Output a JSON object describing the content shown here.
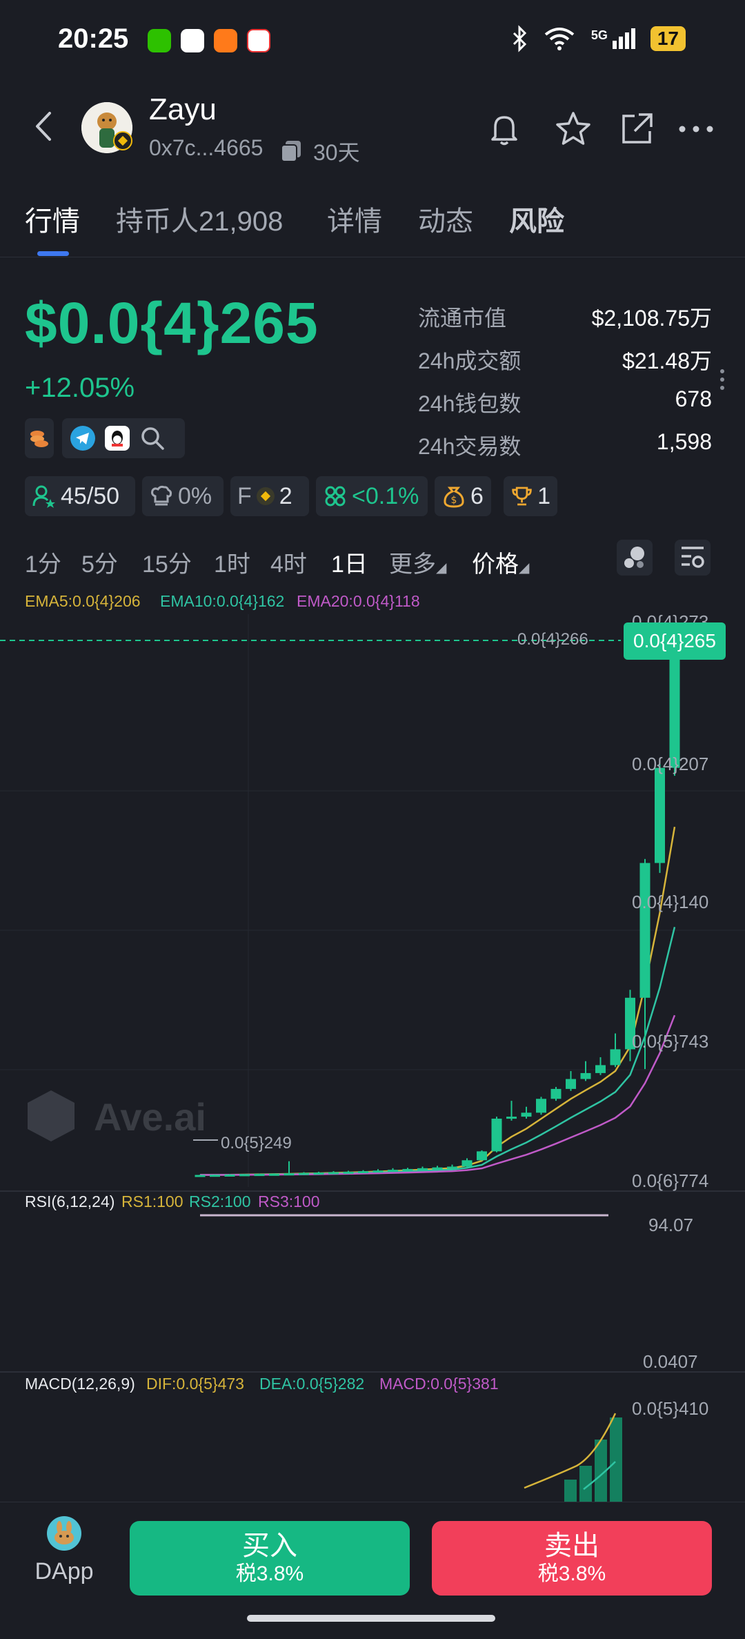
{
  "status_bar": {
    "time": "20:25",
    "network": "5G",
    "battery": "17"
  },
  "header": {
    "token_name": "Zayu",
    "address": "0x7c...4665",
    "age": "30天",
    "icons": [
      "back-icon",
      "bell-icon",
      "star-icon",
      "share-icon",
      "more-icon"
    ]
  },
  "tabs": [
    "行情",
    "持币人21,908",
    "详情",
    "动态",
    "风险"
  ],
  "price": {
    "value": "$0.0{4}265",
    "change": "+12.05%"
  },
  "stats": [
    {
      "label": "流通市值",
      "value": "$2,108.75万"
    },
    {
      "label": "24h成交额",
      "value": "$21.48万"
    },
    {
      "label": "24h钱包数",
      "value": "678"
    },
    {
      "label": "24h交易数",
      "value": "1,598"
    }
  ],
  "badges": {
    "holders": "45/50",
    "tax": "0%",
    "f_label": "F",
    "f_count": "2",
    "ratio": "<0.1%",
    "bag_count": "6",
    "trophy_count": "1"
  },
  "intervals": [
    "1分",
    "5分",
    "15分",
    "1时",
    "4时",
    "1日",
    "更多",
    "价格"
  ],
  "active_interval": "1日",
  "chart_labels": {
    "ema5": "EMA5:0.0{4}206",
    "ema10": "EMA10:0.0{4}162",
    "ema20": "EMA20:0.0{4}118",
    "y_ticks": [
      "0.0{4}273",
      "0.0{4}207",
      "0.0{4}140",
      "0.0{5}743",
      "0.0{6}774"
    ],
    "high_marker": "0.0{4}266",
    "current_tag": "0.0{4}265",
    "low_marker": "0.0{5}249",
    "watermark": "Ave.ai",
    "rsi_title": "RSI(6,12,24)",
    "rs1": "RS1:100",
    "rs2": "RS2:100",
    "rs3": "RS3:100",
    "rsi_hi": "94.07",
    "rsi_lo": "0.0407",
    "macd_title": "MACD(12,26,9)",
    "dif": "DIF:0.0{5}473",
    "dea": "DEA:0.0{5}282",
    "macd": "MACD:0.0{5}381",
    "macd_tick": "0.0{5}410"
  },
  "colors": {
    "up": "#1ec58e",
    "down": "#f23f5a",
    "ema5": "#d6b43a",
    "ema10": "#2fc4a3",
    "ema20": "#c05ac8",
    "accent": "#3e78f0"
  },
  "chart_data": {
    "type": "candlestick",
    "note_units": "price in units of 1e-5 USD",
    "candles": [
      {
        "o": 0.25,
        "c": 0.26,
        "h": 0.27,
        "l": 0.24
      },
      {
        "o": 0.26,
        "c": 0.27,
        "h": 0.28,
        "l": 0.25
      },
      {
        "o": 0.27,
        "c": 0.28,
        "h": 0.3,
        "l": 0.26
      },
      {
        "o": 0.28,
        "c": 0.3,
        "h": 0.31,
        "l": 0.27
      },
      {
        "o": 0.3,
        "c": 0.31,
        "h": 0.33,
        "l": 0.29
      },
      {
        "o": 0.31,
        "c": 0.32,
        "h": 0.34,
        "l": 0.3
      },
      {
        "o": 0.32,
        "c": 0.34,
        "h": 0.95,
        "l": 0.31
      },
      {
        "o": 0.34,
        "c": 0.36,
        "h": 0.4,
        "l": 0.33
      },
      {
        "o": 0.36,
        "c": 0.38,
        "h": 0.42,
        "l": 0.35
      },
      {
        "o": 0.38,
        "c": 0.4,
        "h": 0.45,
        "l": 0.37
      },
      {
        "o": 0.4,
        "c": 0.42,
        "h": 0.47,
        "l": 0.39
      },
      {
        "o": 0.42,
        "c": 0.45,
        "h": 0.5,
        "l": 0.41
      },
      {
        "o": 0.45,
        "c": 0.48,
        "h": 0.55,
        "l": 0.44
      },
      {
        "o": 0.48,
        "c": 0.52,
        "h": 0.6,
        "l": 0.47
      },
      {
        "o": 0.52,
        "c": 0.56,
        "h": 0.62,
        "l": 0.51
      },
      {
        "o": 0.56,
        "c": 0.6,
        "h": 0.68,
        "l": 0.55
      },
      {
        "o": 0.6,
        "c": 0.64,
        "h": 0.72,
        "l": 0.59
      },
      {
        "o": 0.64,
        "c": 0.68,
        "h": 0.78,
        "l": 0.63
      },
      {
        "o": 0.68,
        "c": 1.0,
        "h": 1.1,
        "l": 0.66
      },
      {
        "o": 1.0,
        "c": 1.45,
        "h": 1.5,
        "l": 0.98
      },
      {
        "o": 1.45,
        "c": 3.1,
        "h": 3.2,
        "l": 1.4
      },
      {
        "o": 3.1,
        "c": 3.2,
        "h": 4.0,
        "l": 3.0
      },
      {
        "o": 3.2,
        "c": 3.4,
        "h": 3.7,
        "l": 3.1
      },
      {
        "o": 3.4,
        "c": 4.1,
        "h": 4.2,
        "l": 3.3
      },
      {
        "o": 4.1,
        "c": 4.6,
        "h": 4.7,
        "l": 4.0
      },
      {
        "o": 4.6,
        "c": 5.1,
        "h": 5.5,
        "l": 4.5
      },
      {
        "o": 5.1,
        "c": 5.4,
        "h": 6.0,
        "l": 5.0
      },
      {
        "o": 5.4,
        "c": 5.8,
        "h": 6.2,
        "l": 5.3
      },
      {
        "o": 5.8,
        "c": 6.6,
        "h": 7.4,
        "l": 5.7
      },
      {
        "o": 6.6,
        "c": 9.2,
        "h": 9.6,
        "l": 6.0
      },
      {
        "o": 9.2,
        "c": 16.0,
        "h": 16.2,
        "l": 5.6
      },
      {
        "o": 16.0,
        "c": 20.8,
        "h": 21.0,
        "l": 15.5
      },
      {
        "o": 20.8,
        "c": 26.5,
        "h": 26.6,
        "l": 20.4
      }
    ],
    "ema5_end": 20.6,
    "ema10_end": 16.2,
    "ema20_end": 11.8,
    "y_range": [
      0,
      27.3
    ]
  },
  "bottom": {
    "dapp": "DApp",
    "buy": "买入",
    "buy_tax": "税3.8%",
    "sell": "卖出",
    "sell_tax": "税3.8%"
  }
}
